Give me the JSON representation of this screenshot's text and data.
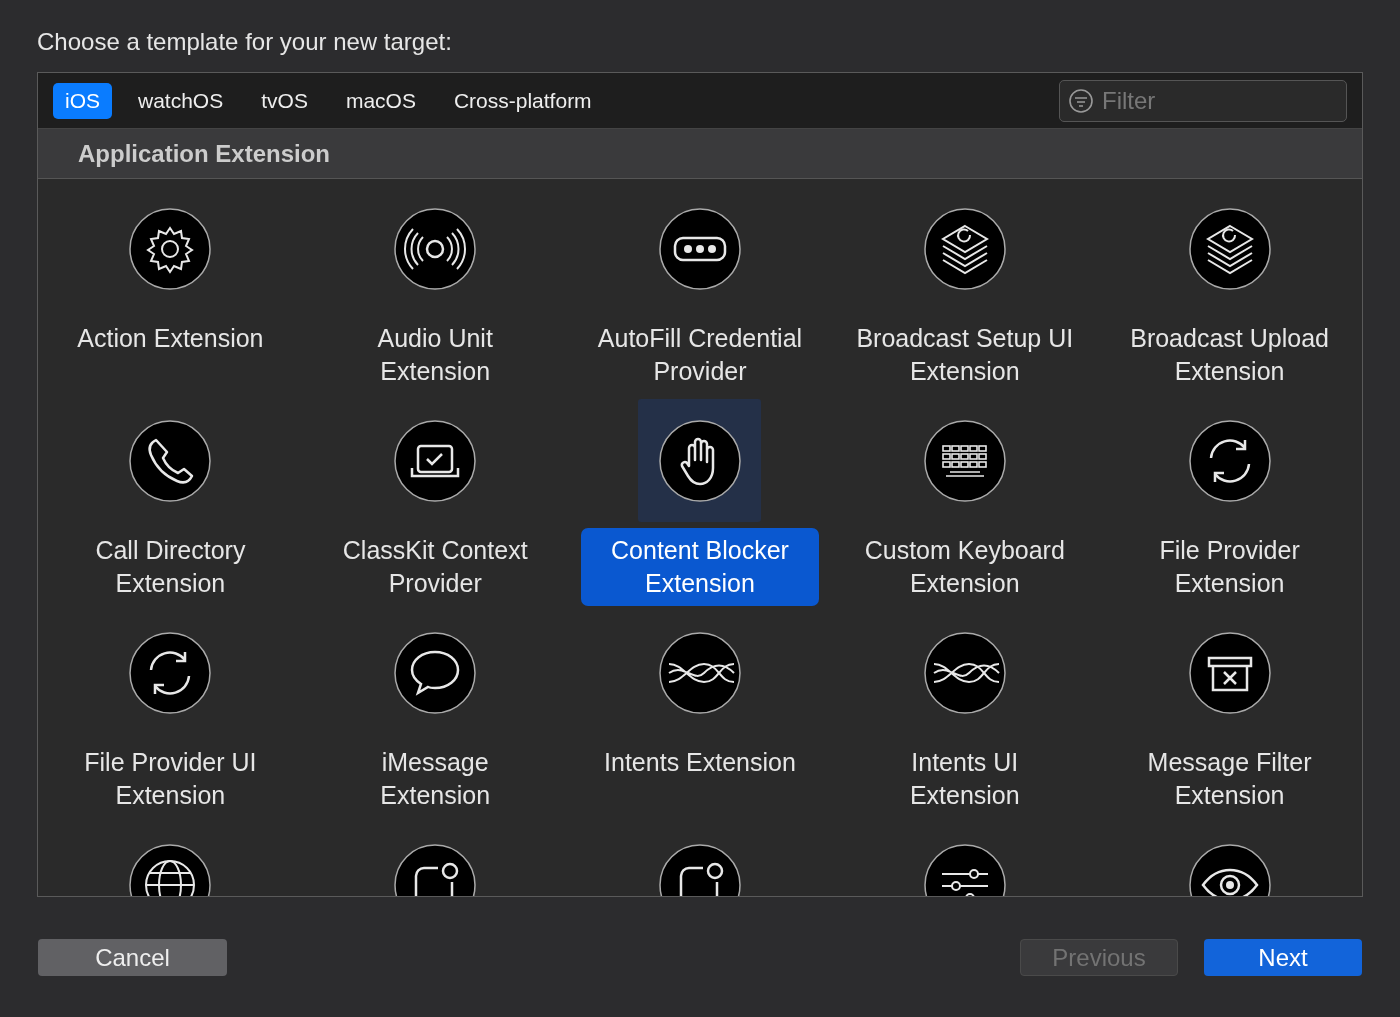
{
  "prompt": "Choose a template for your new target:",
  "tabs": [
    {
      "label": "iOS",
      "selected": true
    },
    {
      "label": "watchOS",
      "selected": false
    },
    {
      "label": "tvOS",
      "selected": false
    },
    {
      "label": "macOS",
      "selected": false
    },
    {
      "label": "Cross-platform",
      "selected": false
    }
  ],
  "filter": {
    "placeholder": "Filter"
  },
  "section": "Application Extension",
  "templates": [
    {
      "kind": "gear",
      "label": "Action Extension",
      "selected": false
    },
    {
      "kind": "waves",
      "label": "Audio Unit Extension",
      "selected": false
    },
    {
      "kind": "dots",
      "label": "AutoFill Credential Provider",
      "selected": false
    },
    {
      "kind": "stack",
      "label": "Broadcast Setup UI Extension",
      "selected": false
    },
    {
      "kind": "stack",
      "label": "Broadcast Upload Extension",
      "selected": false
    },
    {
      "kind": "phone",
      "label": "Call Directory Extension",
      "selected": false
    },
    {
      "kind": "screen",
      "label": "ClassKit Context Provider",
      "selected": false
    },
    {
      "kind": "hand",
      "label": "Content Blocker Extension",
      "selected": true
    },
    {
      "kind": "keyboard",
      "label": "Custom Keyboard Extension",
      "selected": false
    },
    {
      "kind": "sync",
      "label": "File Provider Extension",
      "selected": false
    },
    {
      "kind": "sync",
      "label": "File Provider UI Extension",
      "selected": false
    },
    {
      "kind": "bubble",
      "label": "iMessage Extension",
      "selected": false
    },
    {
      "kind": "strands",
      "label": "Intents Extension",
      "selected": false
    },
    {
      "kind": "strands",
      "label": "Intents UI Extension",
      "selected": false
    },
    {
      "kind": "bin",
      "label": "Message Filter Extension",
      "selected": false
    },
    {
      "kind": "globe",
      "selected": false
    },
    {
      "kind": "notice",
      "selected": false
    },
    {
      "kind": "notice",
      "selected": false
    },
    {
      "kind": "sliders",
      "selected": false
    },
    {
      "kind": "eye",
      "selected": false
    }
  ],
  "buttons": [
    {
      "kind": "cancel",
      "label": "Cancel",
      "disabled": false
    },
    {
      "kind": "previous",
      "label": "Previous",
      "disabled": true
    },
    {
      "kind": "next",
      "label": "Next",
      "disabled": false
    }
  ]
}
